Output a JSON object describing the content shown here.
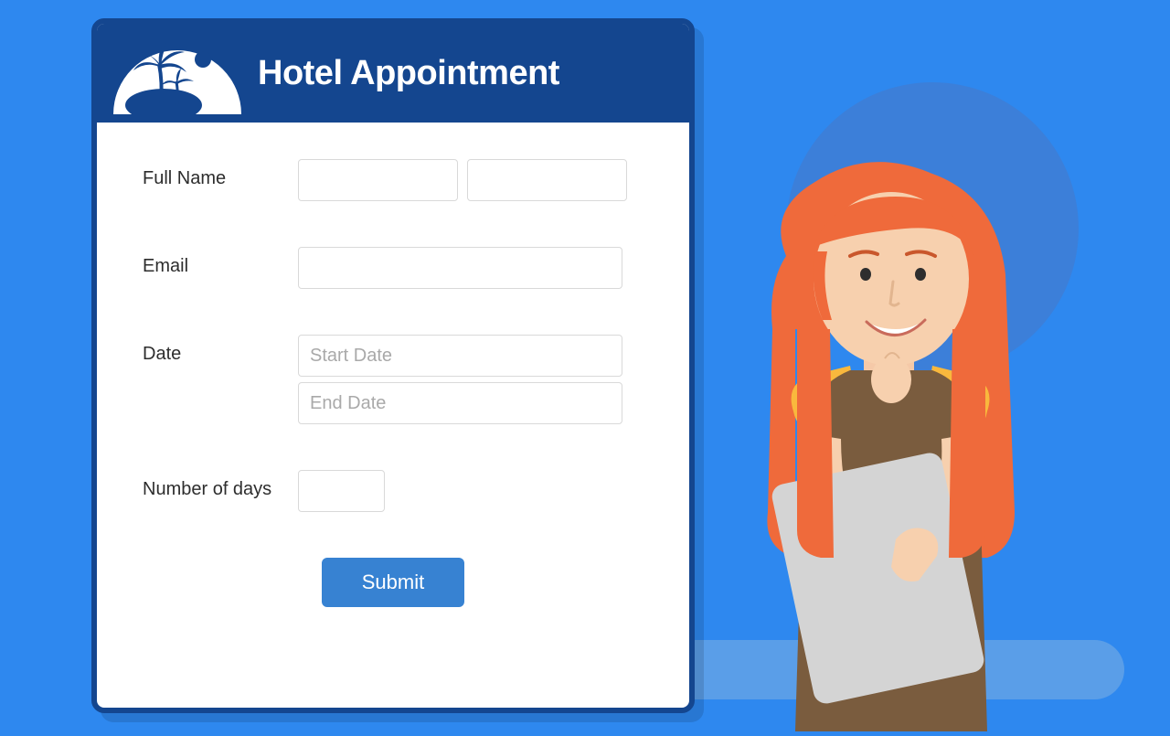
{
  "colors": {
    "page_bg": "#2e88ef",
    "header_bg": "#14468f",
    "submit_bg": "#3782d2",
    "input_border": "#d9d9d9",
    "placeholder": "#a9a9a9"
  },
  "form": {
    "title": "Hotel Appointment",
    "fields": {
      "full_name": {
        "label": "Full Name"
      },
      "email": {
        "label": "Email"
      },
      "date": {
        "label": "Date",
        "start_placeholder": "Start Date",
        "end_placeholder": "End Date"
      },
      "days": {
        "label": "Number of days"
      }
    },
    "submit_label": "Submit"
  },
  "icons": {
    "logo": "palm-beach-icon"
  }
}
